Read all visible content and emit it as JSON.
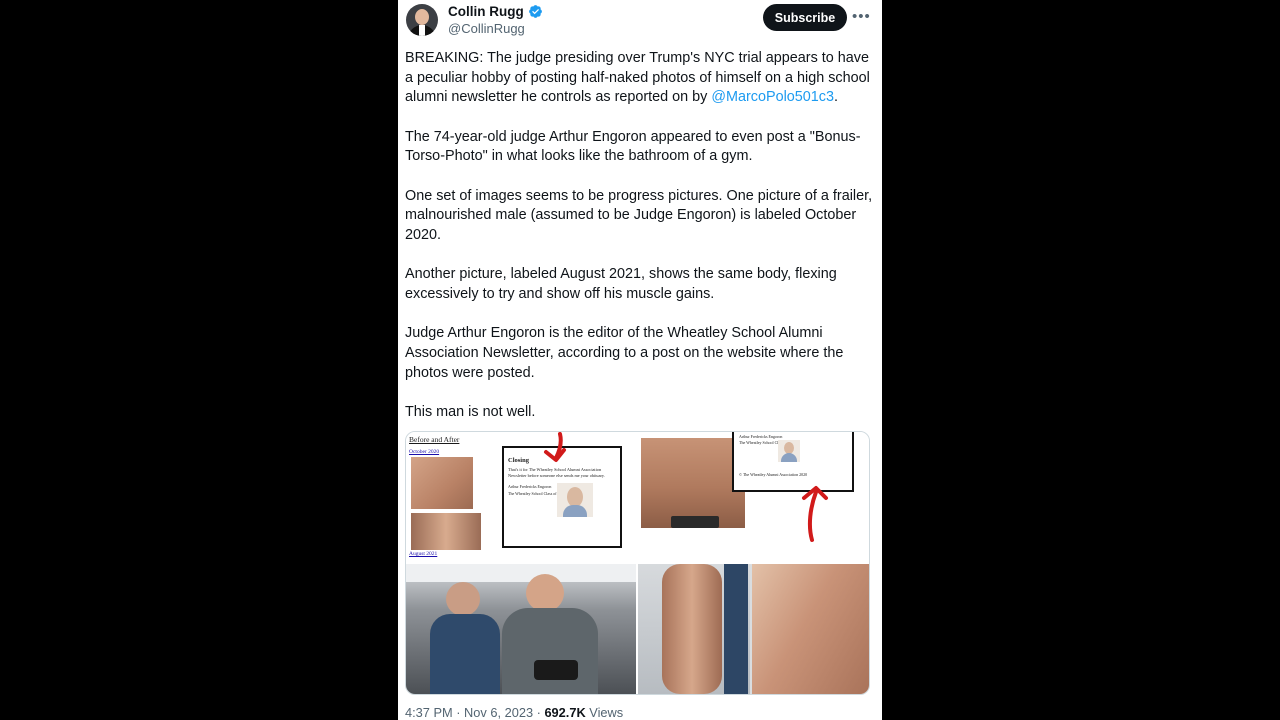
{
  "author": {
    "name": "Collin Rugg",
    "handle": "@CollinRugg"
  },
  "actions": {
    "subscribe_label": "Subscribe",
    "more_label": "•••"
  },
  "post": {
    "paragraphs": [
      {
        "before": "BREAKING: The judge presiding over Trump's NYC trial appears to have a peculiar hobby of posting half-naked photos of himself on a high school alumni newsletter he controls as reported on by ",
        "mention": "@MarcoPolo501c3",
        "after": "."
      },
      {
        "text": "The 74-year-old judge Arthur Engoron appeared to even post a \"Bonus-Torso-Photo\" in what looks like the bathroom of a gym."
      },
      {
        "text": "One set of images seems to be progress pictures. One picture of a frailer, malnourished male (assumed to be Judge Engoron) is labeled October 2020."
      },
      {
        "text": "Another picture, labeled August 2021, shows the same body, flexing excessively to try and show off his muscle gains."
      },
      {
        "text": "Judge Arthur Engoron is the editor of the Wheatley School Alumni Association Newsletter, according to a post on the website where the photos were posted."
      },
      {
        "text": "This man is not well."
      }
    ]
  },
  "media": {
    "tile1": {
      "heading": "Before and After",
      "label_oct": "October 2020",
      "label_aug": "August 2021",
      "box_title": "Closing",
      "box_text": "That's it for The Wheatley School Alumni Association Newsletter before someone else sends me your obituary.",
      "box_sig": "Arthur Fredericks Engoron",
      "box_class": "The Wheatley School Class of 1967"
    },
    "tile2": {
      "box_sig": "Arthur Fredericks Engoron",
      "box_class": "The Wheatley School Class of 1967",
      "copyright": "© The Wheatley Alumni Association 2020"
    }
  },
  "meta": {
    "time": "4:37 PM",
    "separator": " · ",
    "date": "Nov 6, 2023",
    "views_count": "692.7K",
    "views_label": "Views"
  },
  "colors": {
    "accent": "#1d9bf0",
    "text": "#0f1419",
    "muted": "#536471",
    "arrow": "#d11a1a"
  }
}
